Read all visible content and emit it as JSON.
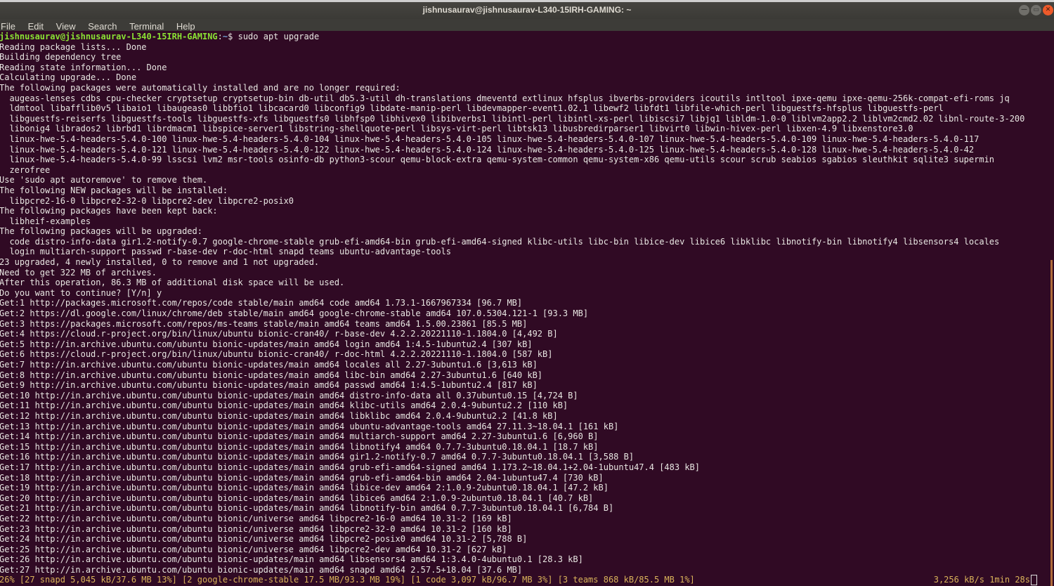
{
  "window": {
    "title": "jishnusaurav@jishnusaurav-L340-15IRH-GAMING: ~",
    "minimize": "—",
    "maximize": "▭",
    "close": "✕"
  },
  "menu": [
    "File",
    "Edit",
    "View",
    "Search",
    "Terminal",
    "Help"
  ],
  "prompt": {
    "user_host": "jishnusaurav@jishnusaurav-L340-15IRH-GAMING",
    "sep": ":",
    "path": "~",
    "symbol": "$",
    "command": " sudo apt upgrade"
  },
  "lines": [
    "Reading package lists... Done",
    "Building dependency tree",
    "Reading state information... Done",
    "Calculating upgrade... Done",
    "The following packages were automatically installed and are no longer required:",
    "  augeas-lenses cdbs cpu-checker cryptsetup cryptsetup-bin db-util db5.3-util dh-translations dmeventd extlinux hfsplus ibverbs-providers icoutils intltool ipxe-qemu ipxe-qemu-256k-compat-efi-roms jq",
    "  ldmtool libafflib0v5 libaio1 libaugeas0 libbfio1 libcacard0 libconfig9 libdate-manip-perl libdevmapper-event1.02.1 libewf2 libfdt1 libfile-which-perl libguestfs-hfsplus libguestfs-perl",
    "  libguestfs-reiserfs libguestfs-tools libguestfs-xfs libguestfs0 libhfsp0 libhivex0 libibverbs1 libintl-perl libintl-xs-perl libiscsi7 libjq1 libldm-1.0-0 liblvm2app2.2 liblvm2cmd2.02 libnl-route-3-200",
    "  libonig4 librados2 librbd1 librdmacm1 libspice-server1 libstring-shellquote-perl libsys-virt-perl libtsk13 libusbredirparser1 libvirt0 libwin-hivex-perl libxen-4.9 libxenstore3.0",
    "  linux-hwe-5.4-headers-5.4.0-100 linux-hwe-5.4-headers-5.4.0-104 linux-hwe-5.4-headers-5.4.0-105 linux-hwe-5.4-headers-5.4.0-107 linux-hwe-5.4-headers-5.4.0-109 linux-hwe-5.4-headers-5.4.0-117",
    "  linux-hwe-5.4-headers-5.4.0-121 linux-hwe-5.4-headers-5.4.0-122 linux-hwe-5.4-headers-5.4.0-124 linux-hwe-5.4-headers-5.4.0-125 linux-hwe-5.4-headers-5.4.0-128 linux-hwe-5.4-headers-5.4.0-42",
    "  linux-hwe-5.4-headers-5.4.0-99 lsscsi lvm2 msr-tools osinfo-db python3-scour qemu-block-extra qemu-system-common qemu-system-x86 qemu-utils scour scrub seabios sgabios sleuthkit sqlite3 supermin",
    "  zerofree",
    "Use 'sudo apt autoremove' to remove them.",
    "The following NEW packages will be installed:",
    "  libpcre2-16-0 libpcre2-32-0 libpcre2-dev libpcre2-posix0",
    "The following packages have been kept back:",
    "  libheif-examples",
    "The following packages will be upgraded:",
    "  code distro-info-data gir1.2-notify-0.7 google-chrome-stable grub-efi-amd64-bin grub-efi-amd64-signed klibc-utils libc-bin libice-dev libice6 libklibc libnotify-bin libnotify4 libsensors4 locales",
    "  login multiarch-support passwd r-base-dev r-doc-html snapd teams ubuntu-advantage-tools",
    "23 upgraded, 4 newly installed, 0 to remove and 1 not upgraded.",
    "Need to get 322 MB of archives.",
    "After this operation, 86.3 MB of additional disk space will be used.",
    "Do you want to continue? [Y/n] y",
    "Get:1 http://packages.microsoft.com/repos/code stable/main amd64 code amd64 1.73.1-1667967334 [96.7 MB]",
    "Get:2 https://dl.google.com/linux/chrome/deb stable/main amd64 google-chrome-stable amd64 107.0.5304.121-1 [93.3 MB]",
    "Get:3 https://packages.microsoft.com/repos/ms-teams stable/main amd64 teams amd64 1.5.00.23861 [85.5 MB]",
    "Get:4 https://cloud.r-project.org/bin/linux/ubuntu bionic-cran40/ r-base-dev 4.2.2.20221110-1.1804.0 [4,492 B]",
    "Get:5 http://in.archive.ubuntu.com/ubuntu bionic-updates/main amd64 login amd64 1:4.5-1ubuntu2.4 [307 kB]",
    "Get:6 https://cloud.r-project.org/bin/linux/ubuntu bionic-cran40/ r-doc-html 4.2.2.20221110-1.1804.0 [587 kB]",
    "Get:7 http://in.archive.ubuntu.com/ubuntu bionic-updates/main amd64 locales all 2.27-3ubuntu1.6 [3,613 kB]",
    "Get:8 http://in.archive.ubuntu.com/ubuntu bionic-updates/main amd64 libc-bin amd64 2.27-3ubuntu1.6 [640 kB]",
    "Get:9 http://in.archive.ubuntu.com/ubuntu bionic-updates/main amd64 passwd amd64 1:4.5-1ubuntu2.4 [817 kB]",
    "Get:10 http://in.archive.ubuntu.com/ubuntu bionic-updates/main amd64 distro-info-data all 0.37ubuntu0.15 [4,724 B]",
    "Get:11 http://in.archive.ubuntu.com/ubuntu bionic-updates/main amd64 klibc-utils amd64 2.0.4-9ubuntu2.2 [110 kB]",
    "Get:12 http://in.archive.ubuntu.com/ubuntu bionic-updates/main amd64 libklibc amd64 2.0.4-9ubuntu2.2 [41.8 kB]",
    "Get:13 http://in.archive.ubuntu.com/ubuntu bionic-updates/main amd64 ubuntu-advantage-tools amd64 27.11.3~18.04.1 [161 kB]",
    "Get:14 http://in.archive.ubuntu.com/ubuntu bionic-updates/main amd64 multiarch-support amd64 2.27-3ubuntu1.6 [6,960 B]",
    "Get:15 http://in.archive.ubuntu.com/ubuntu bionic-updates/main amd64 libnotify4 amd64 0.7.7-3ubuntu0.18.04.1 [18.7 kB]",
    "Get:16 http://in.archive.ubuntu.com/ubuntu bionic-updates/main amd64 gir1.2-notify-0.7 amd64 0.7.7-3ubuntu0.18.04.1 [3,588 B]",
    "Get:17 http://in.archive.ubuntu.com/ubuntu bionic-updates/main amd64 grub-efi-amd64-signed amd64 1.173.2~18.04.1+2.04-1ubuntu47.4 [483 kB]",
    "Get:18 http://in.archive.ubuntu.com/ubuntu bionic-updates/main amd64 grub-efi-amd64-bin amd64 2.04-1ubuntu47.4 [730 kB]",
    "Get:19 http://in.archive.ubuntu.com/ubuntu bionic-updates/main amd64 libice-dev amd64 2:1.0.9-2ubuntu0.18.04.1 [47.2 kB]",
    "Get:20 http://in.archive.ubuntu.com/ubuntu bionic-updates/main amd64 libice6 amd64 2:1.0.9-2ubuntu0.18.04.1 [40.7 kB]",
    "Get:21 http://in.archive.ubuntu.com/ubuntu bionic-updates/main amd64 libnotify-bin amd64 0.7.7-3ubuntu0.18.04.1 [6,784 B]",
    "Get:22 http://in.archive.ubuntu.com/ubuntu bionic/universe amd64 libpcre2-16-0 amd64 10.31-2 [169 kB]",
    "Get:23 http://in.archive.ubuntu.com/ubuntu bionic/universe amd64 libpcre2-32-0 amd64 10.31-2 [160 kB]",
    "Get:24 http://in.archive.ubuntu.com/ubuntu bionic/universe amd64 libpcre2-posix0 amd64 10.31-2 [5,788 B]",
    "Get:25 http://in.archive.ubuntu.com/ubuntu bionic/universe amd64 libpcre2-dev amd64 10.31-2 [627 kB]",
    "Get:26 http://in.archive.ubuntu.com/ubuntu bionic-updates/main amd64 libsensors4 amd64 1:3.4.0-4ubuntu0.1 [28.3 kB]",
    "Get:27 http://in.archive.ubuntu.com/ubuntu bionic-updates/main amd64 snapd amd64 2.57.5+18.04 [37.6 MB]"
  ],
  "status": {
    "progress": "26% [27 snapd 5,045 kB/37.6 MB 13%] [2 google-chrome-stable 17.5 MB/93.3 MB 19%] [1 code 3,097 kB/96.7 MB 3%] [3 teams 868 kB/85.5 MB 1%]",
    "rate": "3,256 kB/s 1min 28s"
  }
}
